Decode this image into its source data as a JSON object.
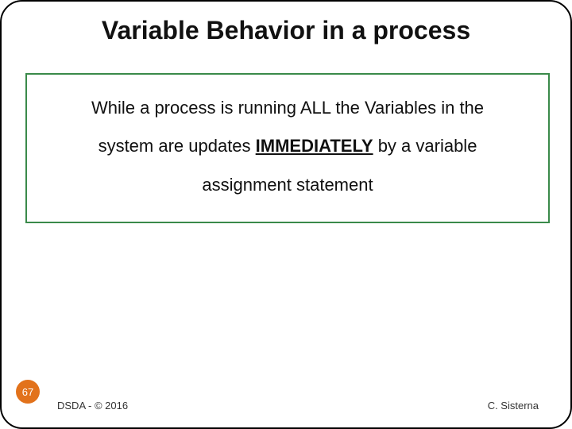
{
  "title": "Variable Behavior in a process",
  "body": {
    "line1_pre": "While a process is running ALL the Variables in the",
    "line2_pre": "system are updates ",
    "line2_emph": "IMMEDIATELY",
    "line2_post": " by a variable",
    "line3": "assignment statement"
  },
  "page_number": "67",
  "footer_left": "DSDA - © 2016",
  "footer_right": "C. Sisterna"
}
